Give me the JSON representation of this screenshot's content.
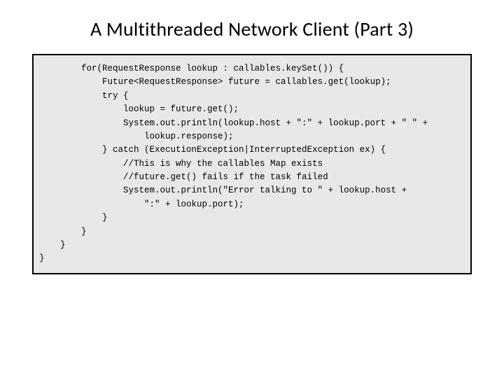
{
  "slide": {
    "title": "A Multithreaded Network Client (Part 3)",
    "code_lines": [
      "        for(RequestResponse lookup : callables.keySet()) {",
      "            Future<RequestResponse> future = callables.get(lookup);",
      "            try {",
      "                lookup = future.get();",
      "                System.out.println(lookup.host + \":\" + lookup.port + \" \" +",
      "                    lookup.response);",
      "            } catch (ExecutionException|InterruptedException ex) {",
      "                //This is why the callables Map exists",
      "                //future.get() fails if the task failed",
      "                System.out.println(\"Error talking to \" + lookup.host +",
      "                    \":\" + lookup.port);",
      "            }",
      "        }",
      "    }",
      "}"
    ]
  }
}
